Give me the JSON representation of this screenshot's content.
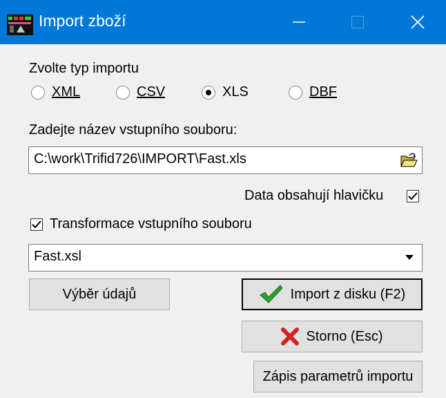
{
  "window": {
    "title": "Import zboží",
    "accent": "#0078d7"
  },
  "import_type": {
    "label": "Zvolte typ importu",
    "options": [
      "XML",
      "CSV",
      "XLS",
      "DBF"
    ],
    "selected": "XLS"
  },
  "input_file": {
    "label": "Zadejte název vstupního souboru:",
    "value": "C:\\work\\Trifid726\\IMPORT\\Fast.xls"
  },
  "header_option": {
    "label": "Data obsahují hlavičku",
    "checked": true
  },
  "transform": {
    "label": "Transformace vstupního souboru",
    "checked": true,
    "selected": "Fast.xsl"
  },
  "buttons": {
    "select_data": "Výběr údajů",
    "import": "Import z disku (F2)",
    "cancel": "Storno (Esc)",
    "save_params": "Zápis parametrů importu"
  },
  "icons": {
    "app": "app-icon",
    "browse": "folder-open-icon",
    "import": "checkmark-icon",
    "cancel": "red-x-icon",
    "dropdown": "chevron-down-icon"
  }
}
